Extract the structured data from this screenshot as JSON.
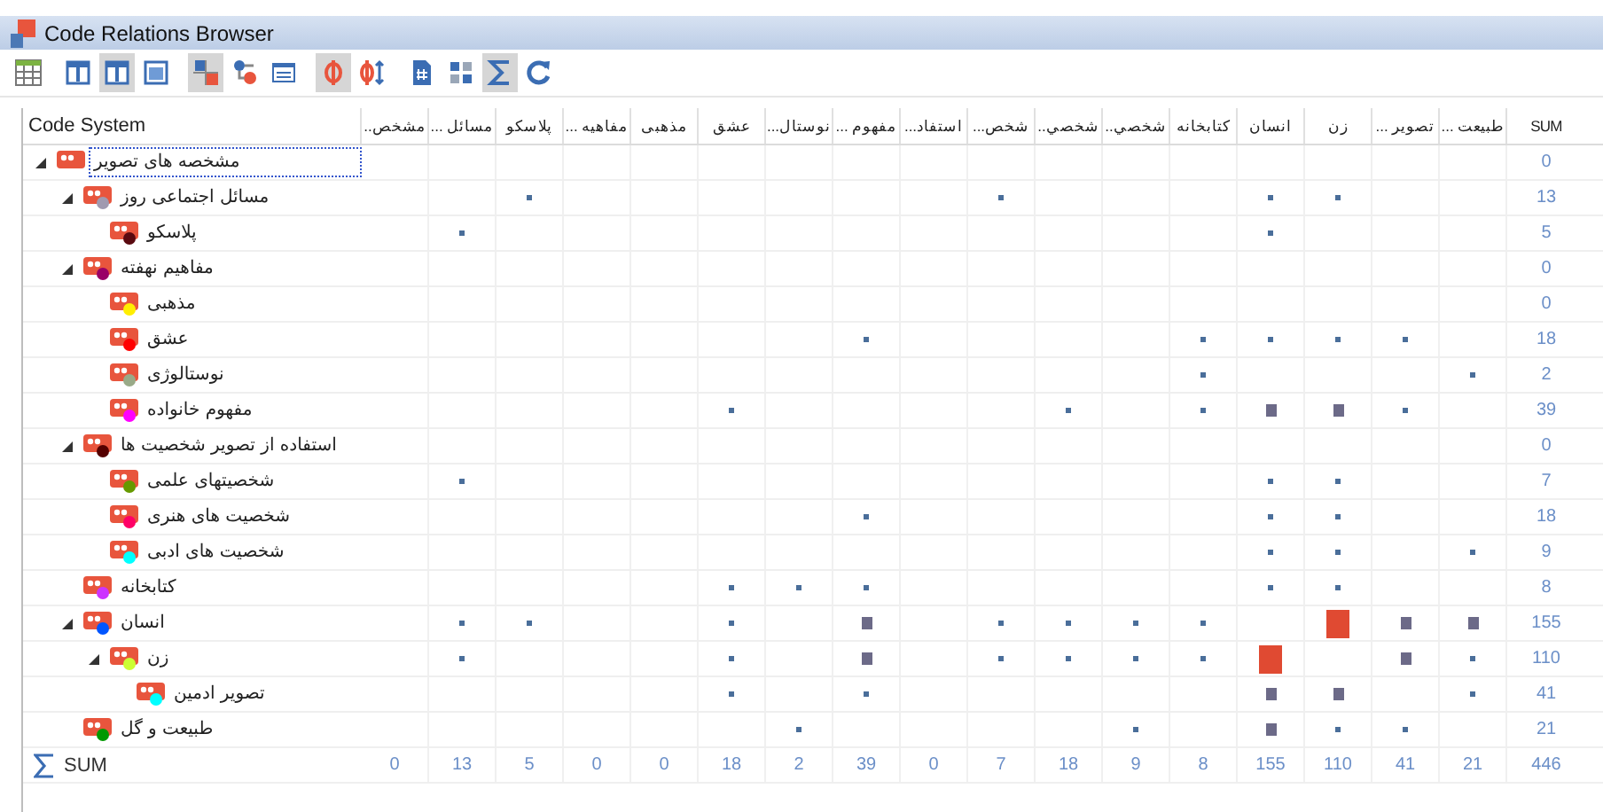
{
  "window": {
    "title": "Code Relations Browser"
  },
  "toolbar": [
    {
      "kind": "grid",
      "pressed": false
    },
    {
      "kind": "column-narrow",
      "pressed": false
    },
    {
      "kind": "column-narrow",
      "pressed": true
    },
    {
      "kind": "column-wide",
      "pressed": false
    },
    {
      "kind": "matrix",
      "pressed": true
    },
    {
      "kind": "links",
      "pressed": false
    },
    {
      "kind": "numbers",
      "pressed": false
    },
    {
      "kind": "split",
      "pressed": true
    },
    {
      "kind": "split-arrows",
      "pressed": false
    },
    {
      "kind": "hash-doc",
      "pressed": false
    },
    {
      "kind": "tiles",
      "pressed": false
    },
    {
      "kind": "sigma",
      "pressed": true
    },
    {
      "kind": "refresh",
      "pressed": false
    }
  ],
  "table": {
    "tree_header": "Code System",
    "sum_header": "SUM",
    "columns": [
      "... طبيعت",
      "... تصوير",
      "زن",
      "انسان",
      "كتابخانه",
      "..شخصي",
      "..شخصي",
      "...شخص",
      "...استفاد",
      "... مفهوم",
      "...نوستال",
      "عشق",
      "مذهبی",
      "... مفاهیه",
      "پلاسکو",
      "... مسائل",
      "..مشخص"
    ],
    "codes": [
      {
        "label": "مشخصه های تصویر",
        "selected": true,
        "expanded": true,
        "sum": "0",
        "cells": [
          {
            "kind": "none"
          },
          {
            "kind": "none"
          },
          {
            "kind": "none"
          },
          {
            "kind": "none"
          },
          {
            "kind": "none"
          },
          {
            "kind": "none"
          },
          {
            "kind": "none"
          },
          {
            "kind": "none"
          },
          {
            "kind": "none"
          },
          {
            "kind": "none"
          },
          {
            "kind": "none"
          },
          {
            "kind": "none"
          },
          {
            "kind": "none"
          },
          {
            "kind": "none"
          },
          {
            "kind": "none"
          },
          {
            "kind": "none"
          },
          {
            "kind": "none"
          }
        ],
        "children": [
          {
            "label": "مسائل اجتماعی روز",
            "color": "#a09ab0",
            "selected": false,
            "expanded": true,
            "sum": "13",
            "cells": [
              {
                "kind": "none"
              },
              {
                "kind": "none"
              },
              {
                "kind": "dot"
              },
              {
                "kind": "dot"
              },
              {
                "kind": "none"
              },
              {
                "kind": "none"
              },
              {
                "kind": "none"
              },
              {
                "kind": "dot"
              },
              {
                "kind": "none"
              },
              {
                "kind": "none"
              },
              {
                "kind": "none"
              },
              {
                "kind": "none"
              },
              {
                "kind": "none"
              },
              {
                "kind": "none"
              },
              {
                "kind": "dot"
              },
              {
                "kind": "none"
              },
              {
                "kind": "none"
              }
            ],
            "children": [
              {
                "label": "پلاسکو",
                "color": "#5a0a10",
                "selected": false,
                "sum": "5",
                "cells": [
                  {
                    "kind": "none"
                  },
                  {
                    "kind": "none"
                  },
                  {
                    "kind": "none"
                  },
                  {
                    "kind": "dot"
                  },
                  {
                    "kind": "none"
                  },
                  {
                    "kind": "none"
                  },
                  {
                    "kind": "none"
                  },
                  {
                    "kind": "none"
                  },
                  {
                    "kind": "none"
                  },
                  {
                    "kind": "none"
                  },
                  {
                    "kind": "none"
                  },
                  {
                    "kind": "none"
                  },
                  {
                    "kind": "none"
                  },
                  {
                    "kind": "none"
                  },
                  {
                    "kind": "none"
                  },
                  {
                    "kind": "dot"
                  },
                  {
                    "kind": "none"
                  }
                ]
              }
            ]
          },
          {
            "label": "مفاهیم نهفته",
            "color": "#990066",
            "selected": false,
            "expanded": true,
            "sum": "0",
            "cells": [
              {
                "kind": "none"
              },
              {
                "kind": "none"
              },
              {
                "kind": "none"
              },
              {
                "kind": "none"
              },
              {
                "kind": "none"
              },
              {
                "kind": "none"
              },
              {
                "kind": "none"
              },
              {
                "kind": "none"
              },
              {
                "kind": "none"
              },
              {
                "kind": "none"
              },
              {
                "kind": "none"
              },
              {
                "kind": "none"
              },
              {
                "kind": "none"
              },
              {
                "kind": "none"
              },
              {
                "kind": "none"
              },
              {
                "kind": "none"
              },
              {
                "kind": "none"
              }
            ],
            "children": [
              {
                "label": "مذهبی",
                "color": "#ffee00",
                "selected": false,
                "sum": "0",
                "cells": [
                  {
                    "kind": "none"
                  },
                  {
                    "kind": "none"
                  },
                  {
                    "kind": "none"
                  },
                  {
                    "kind": "none"
                  },
                  {
                    "kind": "none"
                  },
                  {
                    "kind": "none"
                  },
                  {
                    "kind": "none"
                  },
                  {
                    "kind": "none"
                  },
                  {
                    "kind": "none"
                  },
                  {
                    "kind": "none"
                  },
                  {
                    "kind": "none"
                  },
                  {
                    "kind": "none"
                  },
                  {
                    "kind": "none"
                  },
                  {
                    "kind": "none"
                  },
                  {
                    "kind": "none"
                  },
                  {
                    "kind": "none"
                  },
                  {
                    "kind": "none"
                  }
                ]
              },
              {
                "label": "عشق",
                "color": "#ff0000",
                "selected": false,
                "sum": "18",
                "cells": [
                  {
                    "kind": "none"
                  },
                  {
                    "kind": "dot"
                  },
                  {
                    "kind": "dot"
                  },
                  {
                    "kind": "dot"
                  },
                  {
                    "kind": "dot"
                  },
                  {
                    "kind": "none"
                  },
                  {
                    "kind": "none"
                  },
                  {
                    "kind": "none"
                  },
                  {
                    "kind": "none"
                  },
                  {
                    "kind": "dot"
                  },
                  {
                    "kind": "none"
                  },
                  {
                    "kind": "none"
                  },
                  {
                    "kind": "none"
                  },
                  {
                    "kind": "none"
                  },
                  {
                    "kind": "none"
                  },
                  {
                    "kind": "none"
                  },
                  {
                    "kind": "none"
                  }
                ]
              },
              {
                "label": "نوستالوژی",
                "color": "#99aa88",
                "selected": false,
                "sum": "2",
                "cells": [
                  {
                    "kind": "dot"
                  },
                  {
                    "kind": "none"
                  },
                  {
                    "kind": "none"
                  },
                  {
                    "kind": "none"
                  },
                  {
                    "kind": "dot"
                  },
                  {
                    "kind": "none"
                  },
                  {
                    "kind": "none"
                  },
                  {
                    "kind": "none"
                  },
                  {
                    "kind": "none"
                  },
                  {
                    "kind": "none"
                  },
                  {
                    "kind": "none"
                  },
                  {
                    "kind": "none"
                  },
                  {
                    "kind": "none"
                  },
                  {
                    "kind": "none"
                  },
                  {
                    "kind": "none"
                  },
                  {
                    "kind": "none"
                  },
                  {
                    "kind": "none"
                  }
                ]
              },
              {
                "label": "مفهوم خانواده",
                "color": "#ff00ff",
                "selected": false,
                "sum": "39",
                "cells": [
                  {
                    "kind": "none"
                  },
                  {
                    "kind": "dot"
                  },
                  {
                    "kind": "square"
                  },
                  {
                    "kind": "square"
                  },
                  {
                    "kind": "dot"
                  },
                  {
                    "kind": "none"
                  },
                  {
                    "kind": "dot"
                  },
                  {
                    "kind": "none"
                  },
                  {
                    "kind": "none"
                  },
                  {
                    "kind": "none"
                  },
                  {
                    "kind": "none"
                  },
                  {
                    "kind": "dot"
                  },
                  {
                    "kind": "none"
                  },
                  {
                    "kind": "none"
                  },
                  {
                    "kind": "none"
                  },
                  {
                    "kind": "none"
                  },
                  {
                    "kind": "none"
                  }
                ]
              }
            ]
          },
          {
            "label": "استفاده از تصویر شخصیت ها",
            "color": "#550000",
            "selected": false,
            "expanded": true,
            "sum": "0",
            "cells": [
              {
                "kind": "none"
              },
              {
                "kind": "none"
              },
              {
                "kind": "none"
              },
              {
                "kind": "none"
              },
              {
                "kind": "none"
              },
              {
                "kind": "none"
              },
              {
                "kind": "none"
              },
              {
                "kind": "none"
              },
              {
                "kind": "none"
              },
              {
                "kind": "none"
              },
              {
                "kind": "none"
              },
              {
                "kind": "none"
              },
              {
                "kind": "none"
              },
              {
                "kind": "none"
              },
              {
                "kind": "none"
              },
              {
                "kind": "none"
              },
              {
                "kind": "none"
              }
            ],
            "children": [
              {
                "label": "شخصیتهای علمی",
                "color": "#669900",
                "selected": false,
                "sum": "7",
                "cells": [
                  {
                    "kind": "none"
                  },
                  {
                    "kind": "none"
                  },
                  {
                    "kind": "dot"
                  },
                  {
                    "kind": "dot"
                  },
                  {
                    "kind": "none"
                  },
                  {
                    "kind": "none"
                  },
                  {
                    "kind": "none"
                  },
                  {
                    "kind": "none"
                  },
                  {
                    "kind": "none"
                  },
                  {
                    "kind": "none"
                  },
                  {
                    "kind": "none"
                  },
                  {
                    "kind": "none"
                  },
                  {
                    "kind": "none"
                  },
                  {
                    "kind": "none"
                  },
                  {
                    "kind": "none"
                  },
                  {
                    "kind": "dot"
                  },
                  {
                    "kind": "none"
                  }
                ]
              },
              {
                "label": "شخصیت های هنری",
                "color": "#ff0066",
                "selected": false,
                "sum": "18",
                "cells": [
                  {
                    "kind": "none"
                  },
                  {
                    "kind": "none"
                  },
                  {
                    "kind": "dot"
                  },
                  {
                    "kind": "dot"
                  },
                  {
                    "kind": "none"
                  },
                  {
                    "kind": "none"
                  },
                  {
                    "kind": "none"
                  },
                  {
                    "kind": "none"
                  },
                  {
                    "kind": "none"
                  },
                  {
                    "kind": "dot"
                  },
                  {
                    "kind": "none"
                  },
                  {
                    "kind": "none"
                  },
                  {
                    "kind": "none"
                  },
                  {
                    "kind": "none"
                  },
                  {
                    "kind": "none"
                  },
                  {
                    "kind": "none"
                  },
                  {
                    "kind": "none"
                  }
                ]
              },
              {
                "label": "شخصیت های ادبی",
                "color": "#00ffff",
                "selected": false,
                "sum": "9",
                "cells": [
                  {
                    "kind": "dot"
                  },
                  {
                    "kind": "none"
                  },
                  {
                    "kind": "dot"
                  },
                  {
                    "kind": "dot"
                  },
                  {
                    "kind": "none"
                  },
                  {
                    "kind": "none"
                  },
                  {
                    "kind": "none"
                  },
                  {
                    "kind": "none"
                  },
                  {
                    "kind": "none"
                  },
                  {
                    "kind": "none"
                  },
                  {
                    "kind": "none"
                  },
                  {
                    "kind": "none"
                  },
                  {
                    "kind": "none"
                  },
                  {
                    "kind": "none"
                  },
                  {
                    "kind": "none"
                  },
                  {
                    "kind": "none"
                  },
                  {
                    "kind": "none"
                  }
                ]
              }
            ]
          },
          {
            "label": "کتابخانه",
            "color": "#cc33ff",
            "selected": false,
            "sum": "8",
            "cells": [
              {
                "kind": "none"
              },
              {
                "kind": "none"
              },
              {
                "kind": "dot"
              },
              {
                "kind": "dot"
              },
              {
                "kind": "none"
              },
              {
                "kind": "none"
              },
              {
                "kind": "none"
              },
              {
                "kind": "none"
              },
              {
                "kind": "none"
              },
              {
                "kind": "dot"
              },
              {
                "kind": "dot"
              },
              {
                "kind": "dot"
              },
              {
                "kind": "none"
              },
              {
                "kind": "none"
              },
              {
                "kind": "none"
              },
              {
                "kind": "none"
              },
              {
                "kind": "none"
              }
            ]
          },
          {
            "label": "انسان",
            "color": "#0055ff",
            "selected": false,
            "expanded": true,
            "sum": "155",
            "cells": [
              {
                "kind": "square"
              },
              {
                "kind": "square"
              },
              {
                "kind": "large"
              },
              {
                "kind": "none"
              },
              {
                "kind": "dot"
              },
              {
                "kind": "dot"
              },
              {
                "kind": "dot"
              },
              {
                "kind": "dot"
              },
              {
                "kind": "none"
              },
              {
                "kind": "square"
              },
              {
                "kind": "none"
              },
              {
                "kind": "dot"
              },
              {
                "kind": "none"
              },
              {
                "kind": "none"
              },
              {
                "kind": "dot"
              },
              {
                "kind": "dot"
              },
              {
                "kind": "none"
              }
            ],
            "children": [
              {
                "label": "زن",
                "color": "#ccff33",
                "selected": false,
                "expanded": true,
                "sum": "110",
                "cells": [
                  {
                    "kind": "dot"
                  },
                  {
                    "kind": "square"
                  },
                  {
                    "kind": "none"
                  },
                  {
                    "kind": "large"
                  },
                  {
                    "kind": "dot"
                  },
                  {
                    "kind": "dot"
                  },
                  {
                    "kind": "dot"
                  },
                  {
                    "kind": "dot"
                  },
                  {
                    "kind": "none"
                  },
                  {
                    "kind": "square"
                  },
                  {
                    "kind": "none"
                  },
                  {
                    "kind": "dot"
                  },
                  {
                    "kind": "none"
                  },
                  {
                    "kind": "none"
                  },
                  {
                    "kind": "none"
                  },
                  {
                    "kind": "dot"
                  },
                  {
                    "kind": "none"
                  }
                ],
                "children": [
                  {
                    "label": "تصویر ادمین",
                    "color": "#00ffff",
                    "selected": false,
                    "sum": "41",
                    "cells": [
                      {
                        "kind": "dot"
                      },
                      {
                        "kind": "none"
                      },
                      {
                        "kind": "square"
                      },
                      {
                        "kind": "square"
                      },
                      {
                        "kind": "none"
                      },
                      {
                        "kind": "none"
                      },
                      {
                        "kind": "none"
                      },
                      {
                        "kind": "none"
                      },
                      {
                        "kind": "none"
                      },
                      {
                        "kind": "dot"
                      },
                      {
                        "kind": "none"
                      },
                      {
                        "kind": "dot"
                      },
                      {
                        "kind": "none"
                      },
                      {
                        "kind": "none"
                      },
                      {
                        "kind": "none"
                      },
                      {
                        "kind": "none"
                      },
                      {
                        "kind": "none"
                      }
                    ]
                  }
                ]
              }
            ]
          },
          {
            "label": "طبیعت و گل",
            "color": "#009900",
            "selected": false,
            "sum": "21",
            "cells": [
              {
                "kind": "none"
              },
              {
                "kind": "dot"
              },
              {
                "kind": "dot"
              },
              {
                "kind": "square"
              },
              {
                "kind": "none"
              },
              {
                "kind": "dot"
              },
              {
                "kind": "none"
              },
              {
                "kind": "none"
              },
              {
                "kind": "none"
              },
              {
                "kind": "none"
              },
              {
                "kind": "dot"
              },
              {
                "kind": "none"
              },
              {
                "kind": "none"
              },
              {
                "kind": "none"
              },
              {
                "kind": "none"
              },
              {
                "kind": "none"
              },
              {
                "kind": "none"
              }
            ]
          }
        ]
      }
    ],
    "sum_row": {
      "label": "SUM",
      "total": "446",
      "values": [
        "21",
        "41",
        "110",
        "155",
        "8",
        "9",
        "18",
        "7",
        "0",
        "39",
        "2",
        "18",
        "0",
        "0",
        "5",
        "13",
        "0"
      ]
    }
  }
}
